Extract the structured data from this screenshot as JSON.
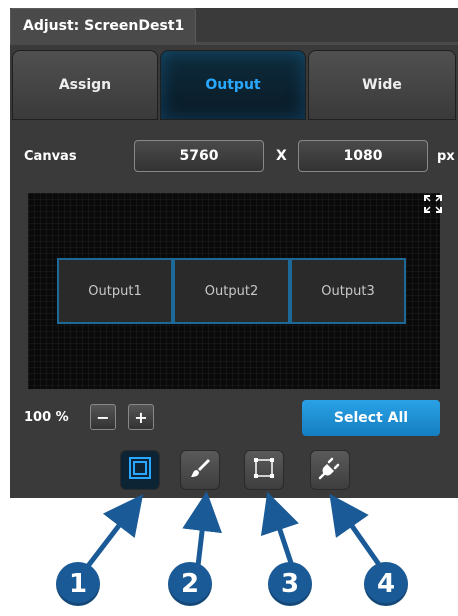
{
  "window": {
    "title": "Adjust: ScreenDest1"
  },
  "tabs": [
    {
      "label": "Assign",
      "active": false
    },
    {
      "label": "Output",
      "active": true
    },
    {
      "label": "Wide",
      "active": false
    }
  ],
  "canvas": {
    "label": "Canvas",
    "width": "5760",
    "separator": "X",
    "height": "1080",
    "unit": "px"
  },
  "outputs": [
    "Output1",
    "Output2",
    "Output3"
  ],
  "zoom": {
    "value": "100 %",
    "minus": "−",
    "plus": "+"
  },
  "select_all": "Select All",
  "toolbar": {
    "tools": [
      {
        "icon": "layer-square-icon",
        "active": true
      },
      {
        "icon": "brush-icon",
        "active": false
      },
      {
        "icon": "crop-frame-icon",
        "active": false
      },
      {
        "icon": "plug-icon",
        "active": false
      }
    ]
  },
  "callouts": [
    "1",
    "2",
    "3",
    "4"
  ],
  "colors": {
    "accent": "#29a8ff",
    "callout": "#1a5a96",
    "output_border": "#1d6a98"
  }
}
